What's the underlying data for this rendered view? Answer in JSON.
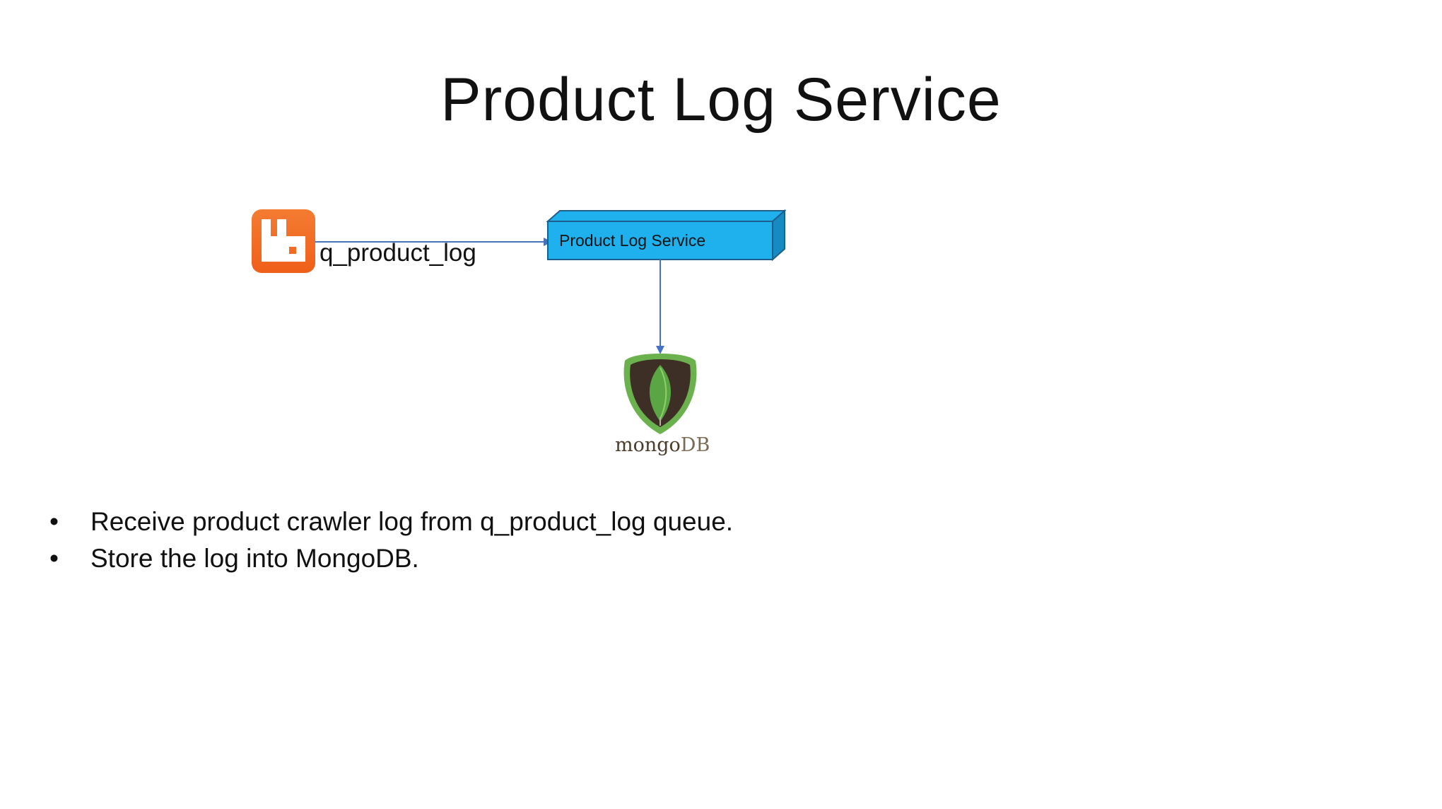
{
  "slide": {
    "title": "Product Log Service"
  },
  "diagram": {
    "queue_label": "q_product_log",
    "service_label": "Product Log Service",
    "database": {
      "wordmark_part_a": "mongo",
      "wordmark_part_b": "DB"
    },
    "icons": {
      "queue_source": "rabbitmq-logo-icon",
      "database": "mongodb-leaf-icon"
    },
    "colors": {
      "rabbitmq_orange": "#f26b22",
      "service_fill": "#1fb1ee",
      "service_side": "#158bc2",
      "arrow": "#4472c4",
      "mongo_shield_outer": "#6bb24f",
      "mongo_shield_inner": "#3d2f25",
      "mongo_leaf": "#5aa544"
    }
  },
  "bullets": [
    "Receive product crawler log from q_product_log queue.",
    "Store the log into MongoDB."
  ]
}
